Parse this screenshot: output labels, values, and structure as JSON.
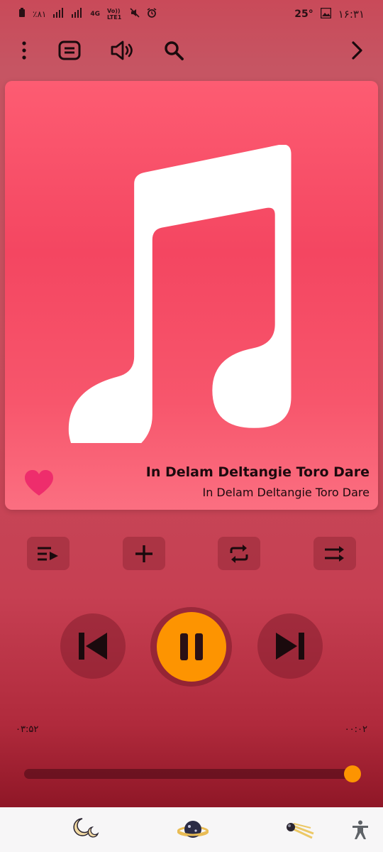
{
  "status_bar": {
    "battery": "٪۸۱",
    "network": "4G",
    "volte": "Vo)) LTE1",
    "temperature": "25°",
    "time": "۱۶:۳۱"
  },
  "toolbar": {
    "icons": [
      "more-vert-icon",
      "lyrics-icon",
      "volume-icon",
      "search-icon",
      "chevron-right-icon"
    ]
  },
  "track": {
    "title": "In Delam Deltangie Toro Dare",
    "artist": "In Delam Deltangie Toro Dare",
    "favorite": true
  },
  "actions": {
    "icons": [
      "queue-icon",
      "add-icon",
      "repeat-icon",
      "shuffle-icon"
    ]
  },
  "playback": {
    "state": "playing",
    "time_total": "۰۳:۵۲",
    "time_elapsed": "۰۰:۰۲",
    "progress": 0.98
  },
  "nav_bar": {
    "icons": [
      "moon-icon",
      "planet-icon",
      "comet-icon",
      "accessibility-icon"
    ]
  },
  "colors": {
    "accent": "#fd9401",
    "heart": "#ee2d6c",
    "card": "#f44661"
  }
}
